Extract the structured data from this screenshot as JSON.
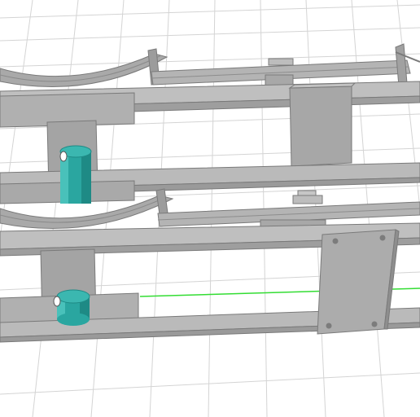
{
  "viewport": {
    "label": "",
    "colors": {
      "background": "#ffffff",
      "grid_line": "#d2d2d2",
      "part_light": "#b9b9b9",
      "part_mid": "#a6a6a6",
      "part_dark": "#8f8f8f",
      "part_shadow": "#7c7c7c",
      "edge": "#6e6e6e",
      "cylinder": "#2aa6a0",
      "cylinder_dark": "#1e8a85",
      "cylinder_light": "#49c1ba",
      "axis_green": "#33dd33"
    },
    "objects": [
      {
        "name": "rail-top-assembly"
      },
      {
        "name": "rail-bottom-assembly"
      },
      {
        "name": "leaf-spring-top"
      },
      {
        "name": "leaf-spring-bottom"
      },
      {
        "name": "cylinder-top"
      },
      {
        "name": "cylinder-bottom"
      },
      {
        "name": "bracket-plate"
      },
      {
        "name": "axis-line-green"
      }
    ]
  }
}
